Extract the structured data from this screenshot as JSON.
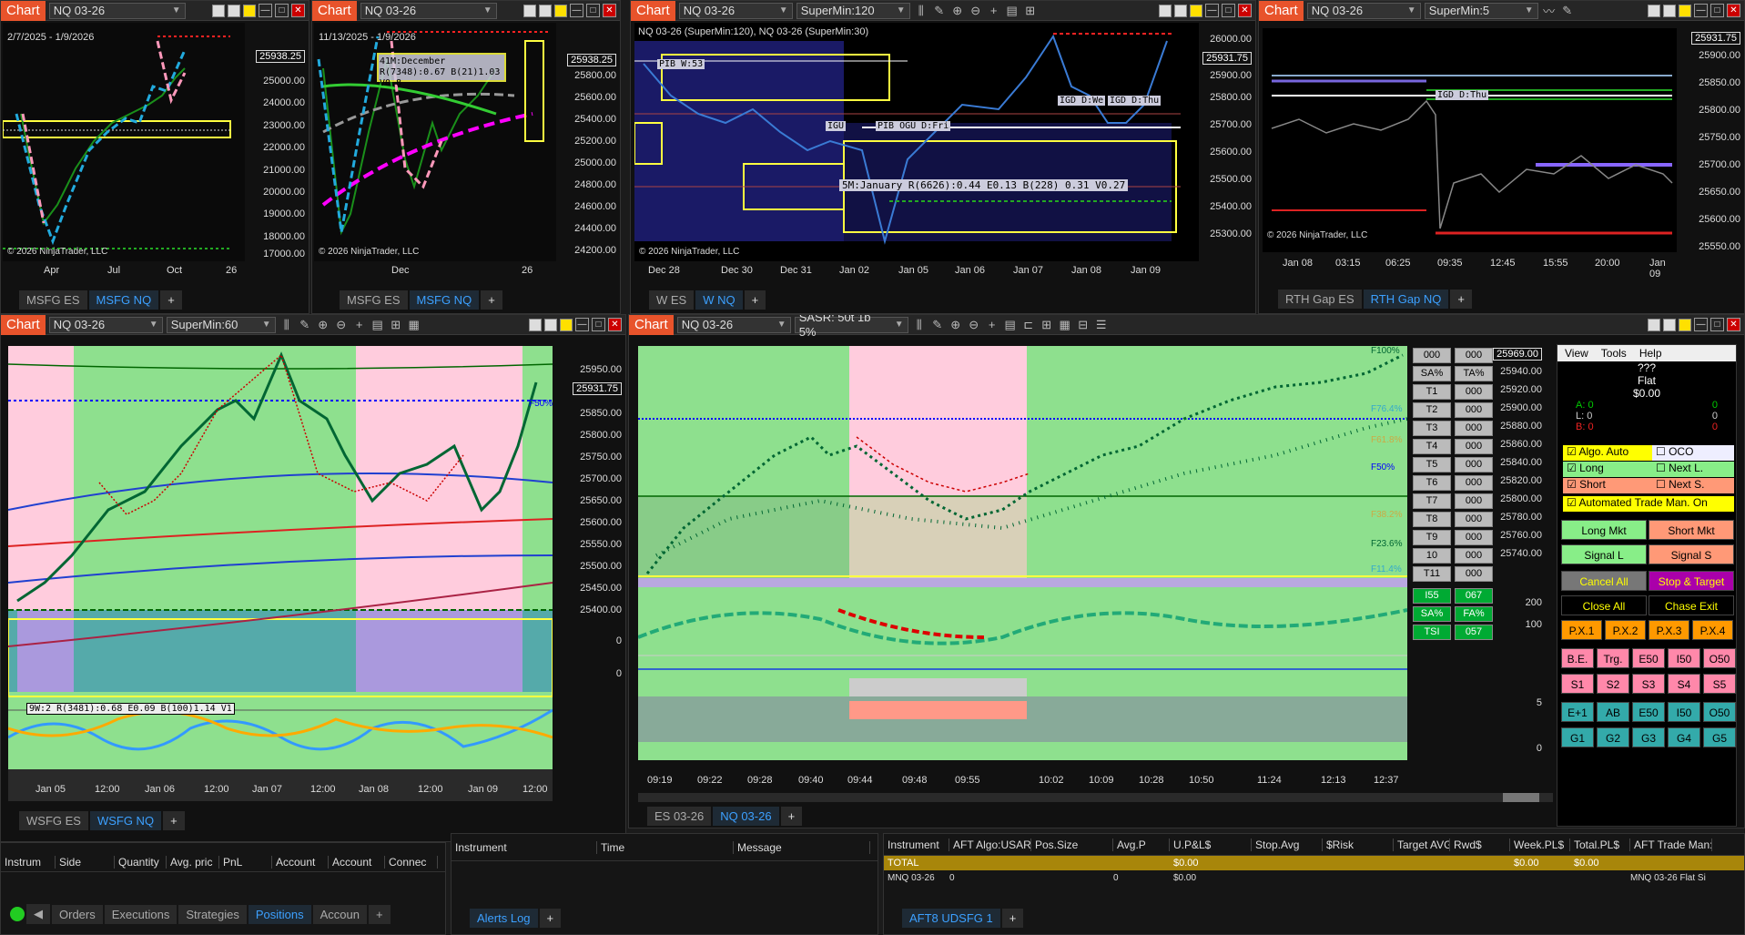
{
  "chart_label": "Chart",
  "win1": {
    "instrument": "NQ 03-26",
    "date_range": "2/7/2025 - 1/9/2026",
    "price": "25938.25",
    "y_ticks": [
      "25000.00",
      "24000.00",
      "23000.00",
      "22000.00",
      "21000.00",
      "20000.00",
      "19000.00",
      "18000.00",
      "17000.00"
    ],
    "x_ticks": [
      "Apr",
      "Jul",
      "Oct",
      "26"
    ],
    "copyright": "© 2026 NinjaTrader, LLC",
    "tabs": [
      "MSFG ES",
      "MSFG NQ",
      "+"
    ]
  },
  "win2": {
    "instrument": "NQ 03-26",
    "date_range": "11/13/2025 - 1/9/2026",
    "price": "25938.25",
    "y_ticks": [
      "25800.00",
      "25600.00",
      "25400.00",
      "25200.00",
      "25000.00",
      "24800.00",
      "24600.00",
      "24400.00",
      "24200.00"
    ],
    "x_ticks": [
      "Dec",
      "26"
    ],
    "copyright": "© 2026 NinjaTrader, LLC",
    "annotation": "41M:December R(7348):0.67 B(21)1.03 V0.8",
    "tabs": [
      "MSFG ES",
      "MSFG NQ",
      "+"
    ]
  },
  "win3": {
    "instrument": "NQ 03-26",
    "template": "SuperMin:120",
    "title": "NQ 03-26 (SuperMin:120), NQ 03-26 (SuperMin:30)",
    "price": "25931.75",
    "y_ticks": [
      "26000.00",
      "25900.00",
      "25800.00",
      "25700.00",
      "25600.00",
      "25500.00",
      "25400.00",
      "25300.00"
    ],
    "x_ticks": [
      "Dec 28",
      "Dec 30",
      "Dec 31",
      "Jan 02",
      "Jan 05",
      "Jan 06",
      "Jan 07",
      "Jan 08",
      "Jan 09"
    ],
    "copyright": "© 2026 NinjaTrader, LLC",
    "annotation": "5M:January R(6626):0.44 E0.13 B(228) 0.31 V0.27",
    "labels": [
      "PIB W:53",
      "IGD D:We",
      "IGD D:Thu",
      "PIB OGU D:Fri",
      "IGU"
    ],
    "tabs": [
      "W ES",
      "W NQ",
      "+"
    ]
  },
  "win4": {
    "instrument": "NQ 03-26",
    "template": "SuperMin:5",
    "price": "25931.75",
    "y_ticks": [
      "25900.00",
      "25850.00",
      "25800.00",
      "25750.00",
      "25700.00",
      "25650.00",
      "25600.00",
      "25550.00"
    ],
    "x_ticks": [
      "Jan 08",
      "03:15",
      "06:25",
      "09:35",
      "12:45",
      "15:55",
      "20:00",
      "Jan 09"
    ],
    "copyright": "© 2026 NinjaTrader, LLC",
    "label": "IGD D:Thu",
    "tabs": [
      "RTH Gap ES",
      "RTH Gap NQ",
      "+"
    ]
  },
  "win5": {
    "instrument": "NQ 03-26",
    "template": "SuperMin:60",
    "price": "25931.75",
    "y_ticks": [
      "25950.00",
      "25900.00",
      "25850.00",
      "25800.00",
      "25750.00",
      "25700.00",
      "25650.00",
      "25600.00",
      "25550.00",
      "25500.00",
      "25450.00",
      "25400.00"
    ],
    "osc_ticks": [
      "0",
      "0"
    ],
    "x_ticks": [
      "Jan 05",
      "12:00",
      "Jan 06",
      "12:00",
      "Jan 07",
      "12:00",
      "Jan 08",
      "12:00",
      "Jan 09",
      "12:00"
    ],
    "annotation": "9W:2 R(3481):0.68 E0.09 B(100)1.14 V1",
    "fib": "F50%",
    "tabs": [
      "WSFG ES",
      "WSFG NQ",
      "+"
    ]
  },
  "win6": {
    "instrument": "NQ 03-26",
    "template": "SASR: 50t 1b 5%",
    "price": "25969.00",
    "y_ticks": [
      "25960.00",
      "25940.00",
      "25920.00",
      "25900.00",
      "25880.00",
      "25860.00",
      "25840.00",
      "25820.00",
      "25800.00",
      "25780.00",
      "25760.00",
      "25740.00"
    ],
    "ind_ticks": [
      "200",
      "100",
      "5",
      "0"
    ],
    "x_ticks": [
      "09:19",
      "09:22",
      "09:28",
      "09:40",
      "09:44",
      "09:48",
      "09:55",
      "10:02",
      "10:09",
      "10:28",
      "10:50",
      "11:24",
      "12:13",
      "12:37"
    ],
    "fibs": [
      "F100%",
      "F76.4%",
      "F61.8%",
      "F50%",
      "F38.2%",
      "F23.6%",
      "F11.4%"
    ],
    "tabs": [
      "ES 03-26",
      "NQ 03-26",
      "+"
    ]
  },
  "grid": {
    "rows": [
      [
        "000",
        "000"
      ],
      [
        "SA%",
        "TA%"
      ],
      [
        "T1",
        "000"
      ],
      [
        "T2",
        "000"
      ],
      [
        "T3",
        "000"
      ],
      [
        "T4",
        "000"
      ],
      [
        "T5",
        "000"
      ],
      [
        "T6",
        "000"
      ],
      [
        "T7",
        "000"
      ],
      [
        "T8",
        "000"
      ],
      [
        "T9",
        "000"
      ],
      [
        "10",
        "000"
      ],
      [
        "T11",
        "000"
      ]
    ],
    "bottom": [
      [
        "I55",
        "067"
      ],
      [
        "SA%",
        "FA%"
      ],
      [
        "TSI",
        "057"
      ]
    ]
  },
  "panel": {
    "menu": [
      "View",
      "Tools",
      "Help"
    ],
    "status1": "???",
    "status2": "Flat",
    "status3": "$0.00",
    "a_label": "A: 0",
    "a_val": "0",
    "l_label": "L: 0",
    "l_val": "0",
    "b_label": "B: 0",
    "b_val": "0",
    "checks": [
      {
        "label": "Algo. Auto",
        "checked": true
      },
      {
        "label": "OCO",
        "checked": false
      },
      {
        "label": "Long",
        "checked": true
      },
      {
        "label": "Next L.",
        "checked": false
      },
      {
        "label": "Short",
        "checked": true
      },
      {
        "label": "Next S.",
        "checked": false
      },
      {
        "label": "Automated Trade Man. On",
        "checked": true
      }
    ],
    "buttons": {
      "long_mkt": "Long Mkt",
      "short_mkt": "Short Mkt",
      "signal_l": "Signal L",
      "signal_s": "Signal S",
      "cancel_all": "Cancel All",
      "stop_target": "Stop & Target",
      "close_all": "Close All",
      "chase_exit": "Chase Exit"
    },
    "px": [
      "P.X.1",
      "P.X.2",
      "P.X.3",
      "P.X.4"
    ],
    "row1": [
      "B.E.",
      "Trg.",
      "E50",
      "I50",
      "O50"
    ],
    "row2": [
      "S1",
      "S2",
      "S3",
      "S4",
      "S5"
    ],
    "row3": [
      "E+1",
      "AB",
      "E50",
      "I50",
      "O50"
    ],
    "row4": [
      "G1",
      "G2",
      "G3",
      "G4",
      "G5"
    ]
  },
  "positions": {
    "cols": [
      "Instrum",
      "Side",
      "Quantity",
      "Avg. pric",
      "PnL",
      "Account",
      "Account",
      "Connec"
    ],
    "tabs": [
      "Orders",
      "Executions",
      "Strategies",
      "Positions",
      "Accoun"
    ]
  },
  "alerts": {
    "cols": [
      "Instrument",
      "Time",
      "Message"
    ],
    "tab": "Alerts Log"
  },
  "aft": {
    "cols": [
      "Instrument",
      "AFT Algo:USAR I",
      "Pos.Size",
      "Avg.P",
      "U.P&L$",
      "Stop.Avg",
      "$Risk",
      "Target AVG",
      "Rwd$",
      "Week.PL$",
      "Total.PL$",
      "AFT Trade Man:L"
    ],
    "total": [
      "TOTAL",
      "",
      "",
      "",
      "$0.00",
      "",
      "",
      "",
      "",
      "$0.00",
      "$0.00",
      ""
    ],
    "row": [
      "MNQ 03-26",
      "0",
      "",
      "0",
      "$0.00",
      "",
      "",
      "",
      "",
      "",
      "",
      "MNQ 03-26 Flat Si"
    ],
    "tab": "AFT8 UDSFG 1"
  }
}
